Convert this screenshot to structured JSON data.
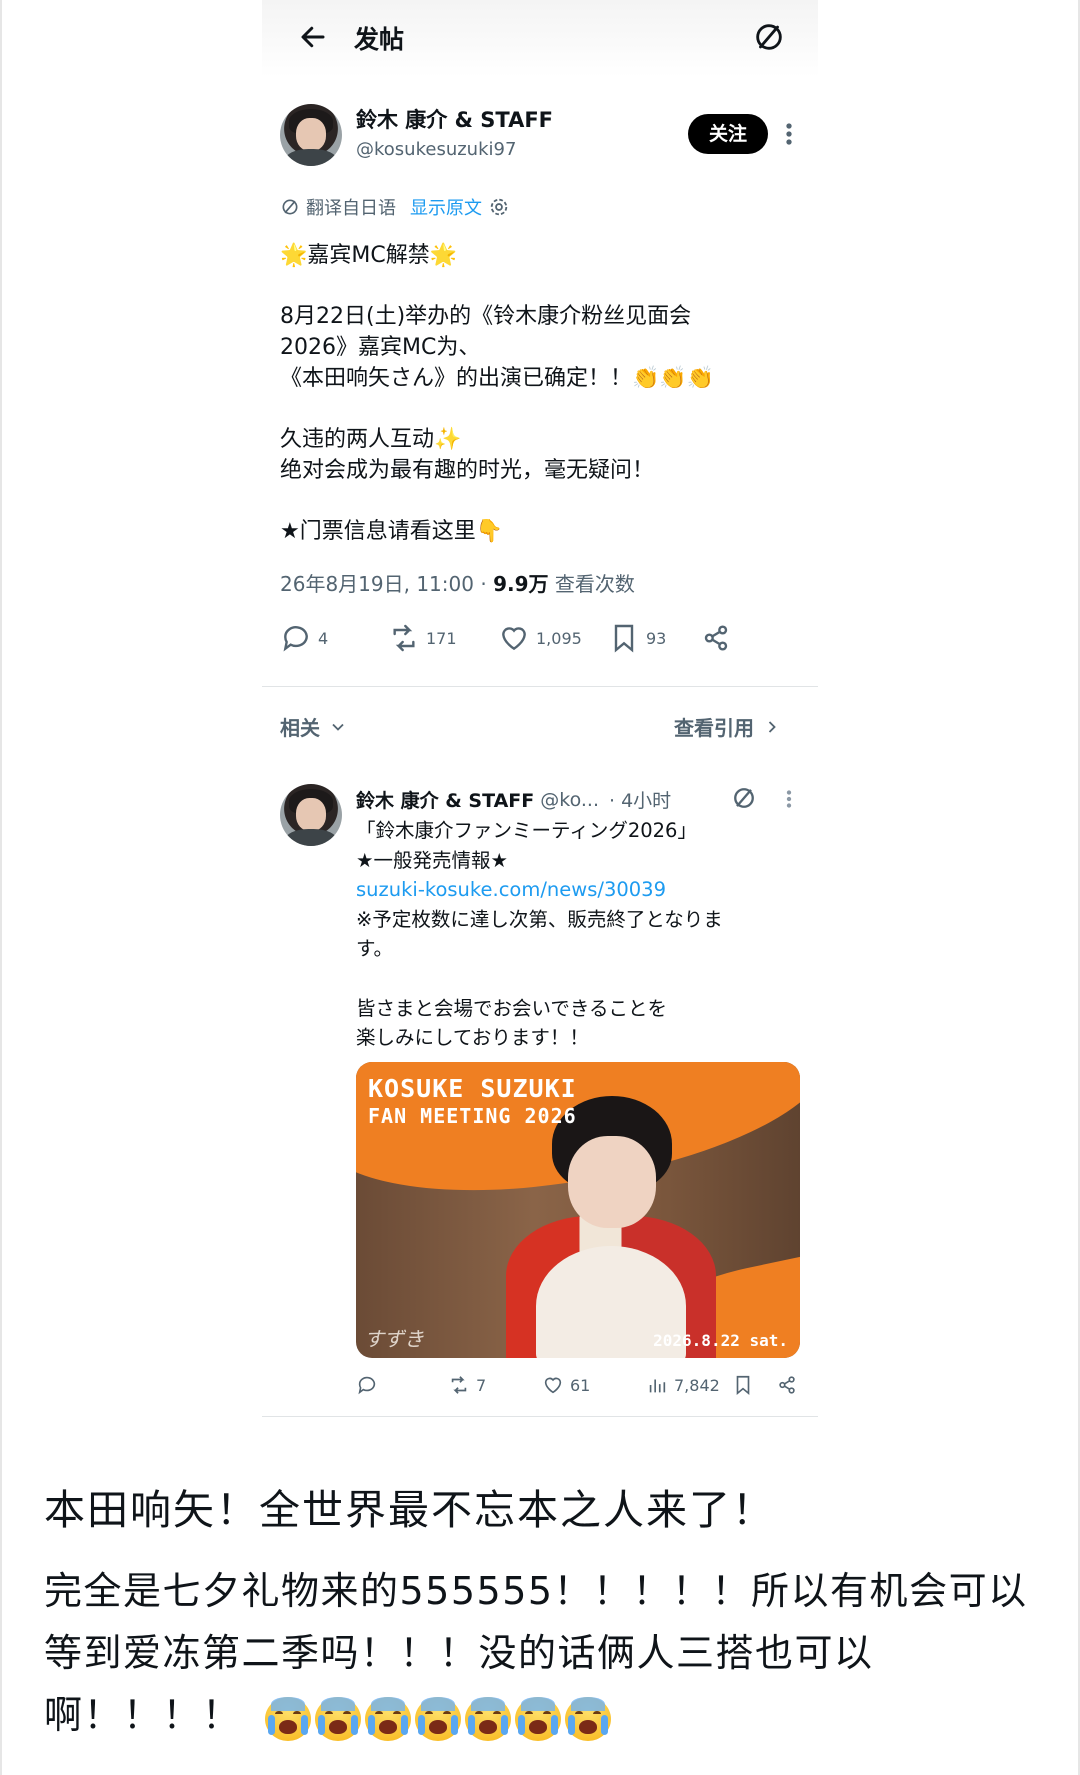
{
  "topbar": {
    "title": "发帖"
  },
  "tweet": {
    "author_name": "鈴木 康介 & STAFF",
    "author_handle": "@kosukesuzuki97",
    "follow_label": "关注",
    "translated_from": "翻译自日语",
    "show_original": "显示原文",
    "body": [
      "🌟嘉宾MC解禁🌟",
      "8月22日(土)举办的《铃木康介粉丝见面会\n2026》嘉宾MC为、\n《本田响矢さん》的出演已确定！！👏👏👏",
      "久违的两人互动✨\n绝对会成为最有趣的时光，毫无疑问！",
      "★门票信息请看这里👇"
    ],
    "timestamp": "26年8月19日, 11:00",
    "views_count": "9.9万",
    "views_label": "查看次数",
    "stats": {
      "replies": "4",
      "retweets": "171",
      "likes": "1,095",
      "bookmarks": "93"
    }
  },
  "related": {
    "label": "相关",
    "quotes_label": "查看引用"
  },
  "quoted_tweet": {
    "author_name": "鈴木 康介 & STAFF",
    "author_handle": "@ko...",
    "time": "· 4小时",
    "body_1": "「鈴木康介ファンミーティング2026」\n★一般発売情報★",
    "link": "suzuki-kosuke.com/news/30039",
    "body_2": "※予定枚数に達し次第、販売終了となりま\nす。",
    "body_3": "皆さまと会場でお会いできることを\n楽しみにしております！！",
    "poster": {
      "line1": "KOSUKE SUZUKI",
      "line2": "FAN MEETING 2026",
      "date": "2026.8.22 sat.",
      "signature": "すずき"
    },
    "stats": {
      "retweets": "7",
      "likes": "61",
      "views": "7,842"
    }
  },
  "caption": {
    "headline": "本田响矢！全世界最不忘本之人来了！",
    "text": "完全是七夕礼物来的555555！！！！！所以有机会可以等到爱冻第二季吗！！！没的话俩人三搭也可以啊！！！！",
    "emoji_name": "loudly-crying-face",
    "emoji_count": 7
  },
  "colors": {
    "accent": "#1d9bf0",
    "muted": "#536471",
    "poster_orange": "#ef7f22"
  }
}
